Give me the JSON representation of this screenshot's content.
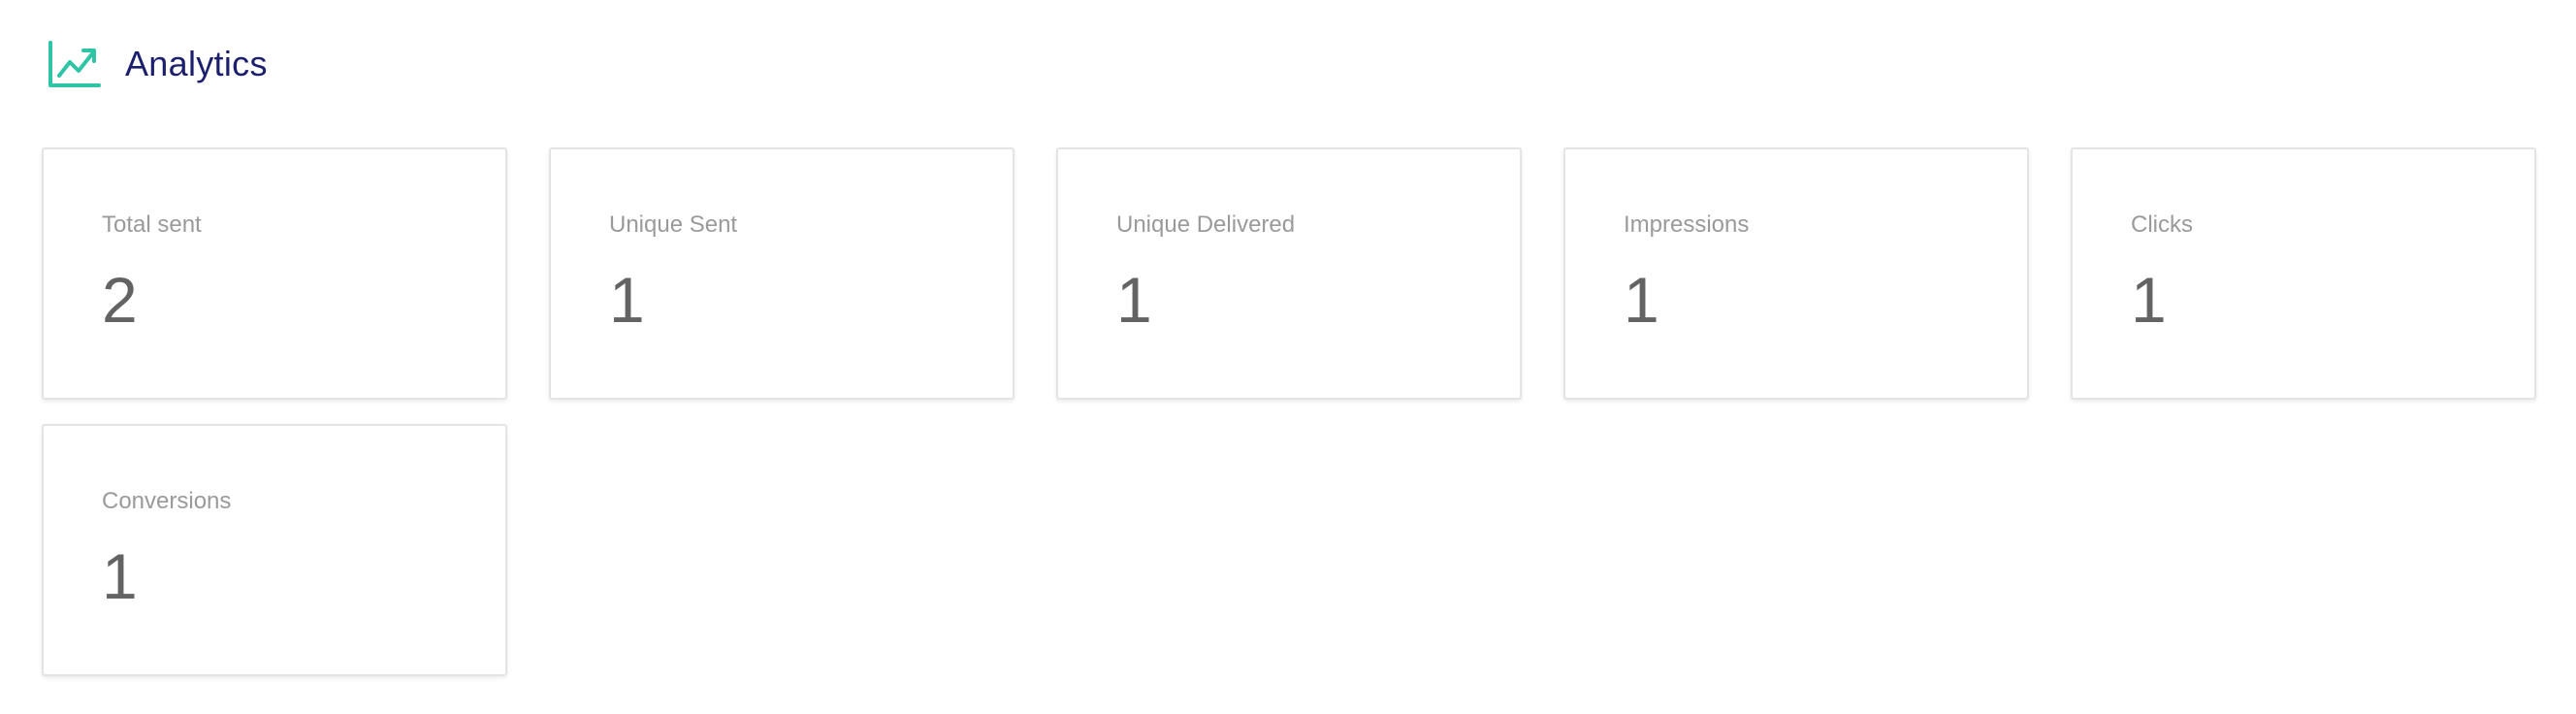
{
  "header": {
    "icon": "trending-up-chart-icon",
    "title": "Analytics",
    "icon_color": "#2ec4a6",
    "title_color": "#1b1f6e"
  },
  "metrics": [
    {
      "label": "Total sent",
      "value": "2"
    },
    {
      "label": "Unique Sent",
      "value": "1"
    },
    {
      "label": "Unique Delivered",
      "value": "1"
    },
    {
      "label": "Impressions",
      "value": "1"
    },
    {
      "label": "Clicks",
      "value": "1"
    },
    {
      "label": "Conversions",
      "value": "1"
    }
  ]
}
